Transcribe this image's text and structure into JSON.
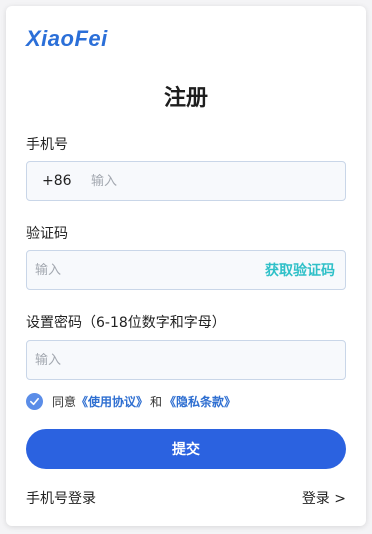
{
  "brand": {
    "logo_text": "XiaoFei",
    "accent": "#2b62e0",
    "code_color": "#2fc0c8"
  },
  "page": {
    "title": "注册"
  },
  "phone": {
    "label": "手机号",
    "country_code": "+86",
    "placeholder": "输入"
  },
  "code": {
    "label": "验证码",
    "placeholder": "输入",
    "get_code": "获取验证码"
  },
  "password": {
    "label": "设置密码（6-18位数字和字母）",
    "placeholder": "输入"
  },
  "agreement": {
    "checked": true,
    "prefix": "同意",
    "terms": "《使用协议》",
    "and": "和",
    "privacy": "《隐私条款》",
    "check_icon": "check-icon"
  },
  "submit": {
    "label": "提交"
  },
  "footer": {
    "phone_login": "手机号登录",
    "login": "登录 >"
  }
}
